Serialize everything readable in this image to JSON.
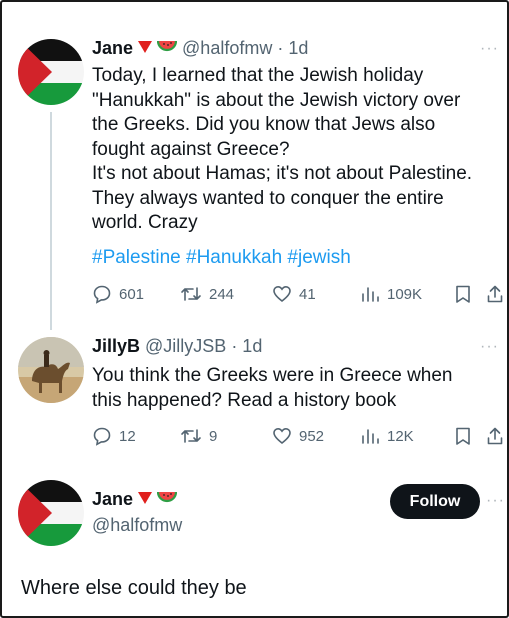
{
  "tweet": {
    "author_name": "Jane",
    "handle": "@halfofmw",
    "time": "· 1d",
    "text": "Today, I learned that the Jewish holiday\n\"Hanukkah\" is about the Jewish victory over\nthe Greeks. Did you know that Jews also\nfought against Greece?\nIt's not about Hamas; it's not about Palestine.\nThey always wanted to conquer the entire\nworld. Crazy",
    "hashtags": "#Palestine #Hanukkah #jewish",
    "replies": "601",
    "retweets": "244",
    "likes": "41",
    "views": "109K"
  },
  "reply": {
    "author_name": "JillyB",
    "handle": "@JillyJSB",
    "time": "· 1d",
    "text": "You think the Greeks were in Greece when\nthis happened? Read a history book",
    "replies": "12",
    "retweets": "9",
    "likes": "952",
    "views": "12K"
  },
  "profile": {
    "author_name": "Jane",
    "handle": "@halfofmw",
    "follow_label": "Follow",
    "text": "Where else could they be"
  },
  "icons": {
    "more": "more-icon",
    "flag": "palestine-flag",
    "heart_accent": "#f4212e",
    "link_color": "#1d9bf0"
  }
}
